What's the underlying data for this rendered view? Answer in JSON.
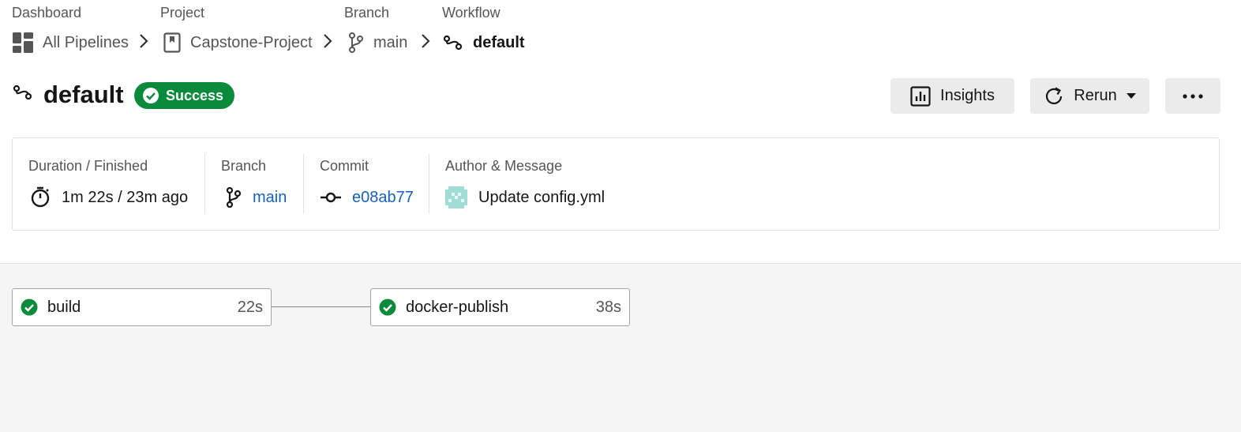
{
  "breadcrumb": {
    "dashboard": {
      "heading": "Dashboard",
      "label": "All Pipelines",
      "icon": "dashboard-icon"
    },
    "project": {
      "heading": "Project",
      "label": "Capstone-Project",
      "icon": "project-icon"
    },
    "branch": {
      "heading": "Branch",
      "label": "main",
      "icon": "branch-icon"
    },
    "workflow": {
      "heading": "Workflow",
      "label": "default",
      "icon": "workflow-icon"
    }
  },
  "header": {
    "title": "default",
    "status": "Success",
    "insights_label": "Insights",
    "rerun_label": "Rerun"
  },
  "summary": {
    "duration": {
      "label": "Duration / Finished",
      "value": "1m 22s / 23m ago"
    },
    "branch": {
      "label": "Branch",
      "value": "main"
    },
    "commit": {
      "label": "Commit",
      "value": "e08ab77"
    },
    "author": {
      "label": "Author & Message",
      "value": "Update config.yml"
    }
  },
  "jobs": [
    {
      "name": "build",
      "duration": "22s",
      "status": "success"
    },
    {
      "name": "docker-publish",
      "duration": "38s",
      "status": "success"
    }
  ],
  "colors": {
    "success": "#0a8a3a",
    "link": "#1760bf",
    "button_bg": "#ebebeb",
    "canvas_bg": "#f5f5f5"
  }
}
